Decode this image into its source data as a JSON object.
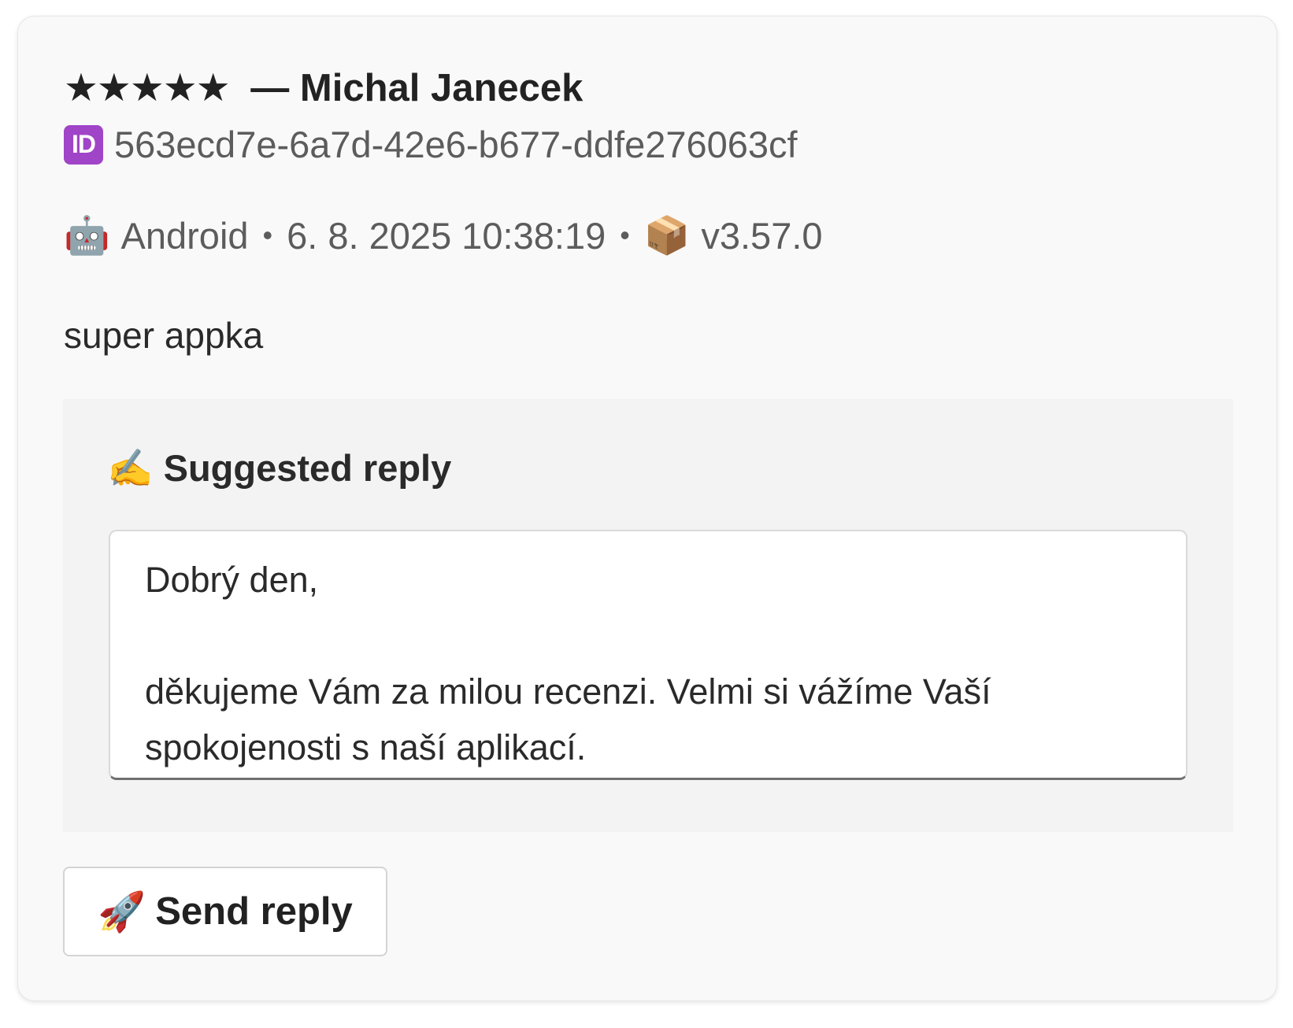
{
  "review": {
    "rating_stars": "★★★★★",
    "rating": 5,
    "rating_max": 5,
    "author_prefix": "—",
    "author": "Michal Janecek",
    "id_badge": "ID",
    "id": "563ecd7e-6a7d-42e6-b677-ddfe276063cf",
    "platform_icon": "🤖",
    "platform": "Android",
    "separator": "•",
    "timestamp": "6. 8. 2025 10:38:19",
    "version_icon": "📦",
    "version": "v3.57.0",
    "text": "super appka"
  },
  "suggested_reply": {
    "heading_icon": "✍️",
    "heading": "Suggested reply",
    "text": "Dobrý den,\n\nděkujeme Vám za milou recenzi. Velmi si vážíme Vaší spokojenosti s naší aplikací."
  },
  "actions": {
    "send_icon": "🚀",
    "send_label": "Send reply"
  },
  "icons": {
    "id_badge": "id-badge-icon",
    "platform": "robot-icon",
    "version": "package-icon",
    "heading": "writing-hand-icon",
    "send": "rocket-icon"
  },
  "colors": {
    "card_background": "#f9f9f9",
    "reply_panel_background": "#f3f3f3",
    "id_badge": "#a044c8",
    "muted_text": "#5c5c5c"
  }
}
